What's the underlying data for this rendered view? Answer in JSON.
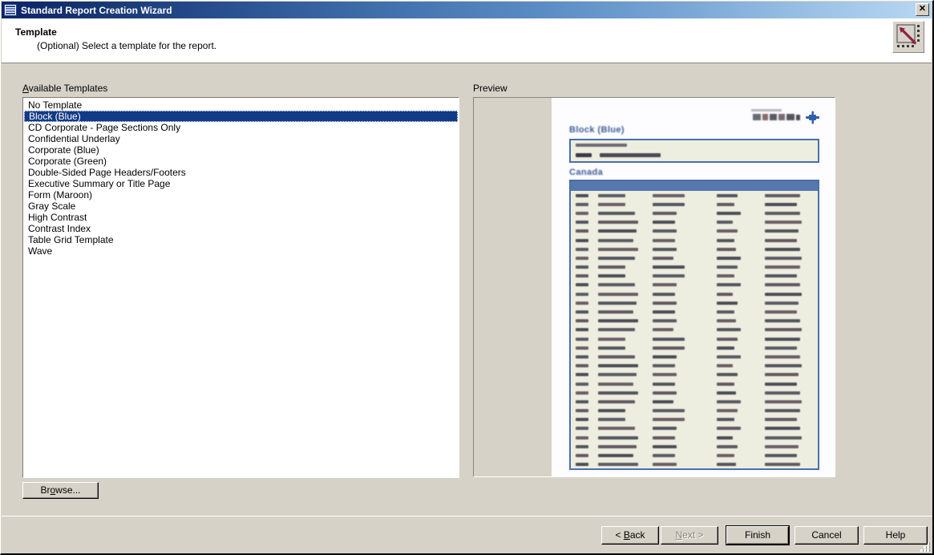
{
  "window": {
    "title": "Standard Report Creation Wizard",
    "icon": "report-book-icon",
    "close_label": "✕"
  },
  "header": {
    "title": "Template",
    "subtitle": "(Optional) Select a template for the report.",
    "icon": "template-arrow-icon"
  },
  "templates_section": {
    "label": "Available Templates",
    "label_accel": "A",
    "items": [
      {
        "label": "No Template",
        "selected": false
      },
      {
        "label": "Block (Blue)",
        "selected": true
      },
      {
        "label": "CD Corporate - Page Sections Only",
        "selected": false
      },
      {
        "label": "Confidential Underlay",
        "selected": false
      },
      {
        "label": "Corporate (Blue)",
        "selected": false
      },
      {
        "label": "Corporate (Green)",
        "selected": false
      },
      {
        "label": "Double-Sided Page Headers/Footers",
        "selected": false
      },
      {
        "label": "Executive Summary or Title Page",
        "selected": false
      },
      {
        "label": "Form (Maroon)",
        "selected": false
      },
      {
        "label": "Gray Scale",
        "selected": false
      },
      {
        "label": "High Contrast",
        "selected": false
      },
      {
        "label": "Contrast Index",
        "selected": false
      },
      {
        "label": "Table Grid Template",
        "selected": false
      },
      {
        "label": "Wave",
        "selected": false
      }
    ],
    "browse_label": "Browse...",
    "browse_accel": "o"
  },
  "preview_section": {
    "label": "Preview",
    "document": {
      "title": "Block (Blue)",
      "section_heading": "Canada",
      "logo": "crystal-reports-logo"
    }
  },
  "footer": {
    "buttons": [
      {
        "name": "back-button",
        "label": "< Back",
        "accel": "B",
        "disabled": false,
        "default": false
      },
      {
        "name": "next-button",
        "label": "Next >",
        "accel": "N",
        "disabled": true,
        "default": false
      },
      {
        "name": "finish-button",
        "label": "Finish",
        "accel": "",
        "disabled": false,
        "default": true
      },
      {
        "name": "cancel-button",
        "label": "Cancel",
        "accel": "",
        "disabled": false,
        "default": false
      },
      {
        "name": "help-button",
        "label": "Help",
        "accel": "",
        "disabled": false,
        "default": false
      }
    ]
  },
  "colors": {
    "titlebar_start": "#0a246a",
    "titlebar_end": "#b9d8f3",
    "selection": "#113a87",
    "face": "#d6d2c8",
    "doc_accent": "#4a6fa8",
    "doc_heading": "#3c5c96",
    "doc_body": "#eeeee0"
  }
}
